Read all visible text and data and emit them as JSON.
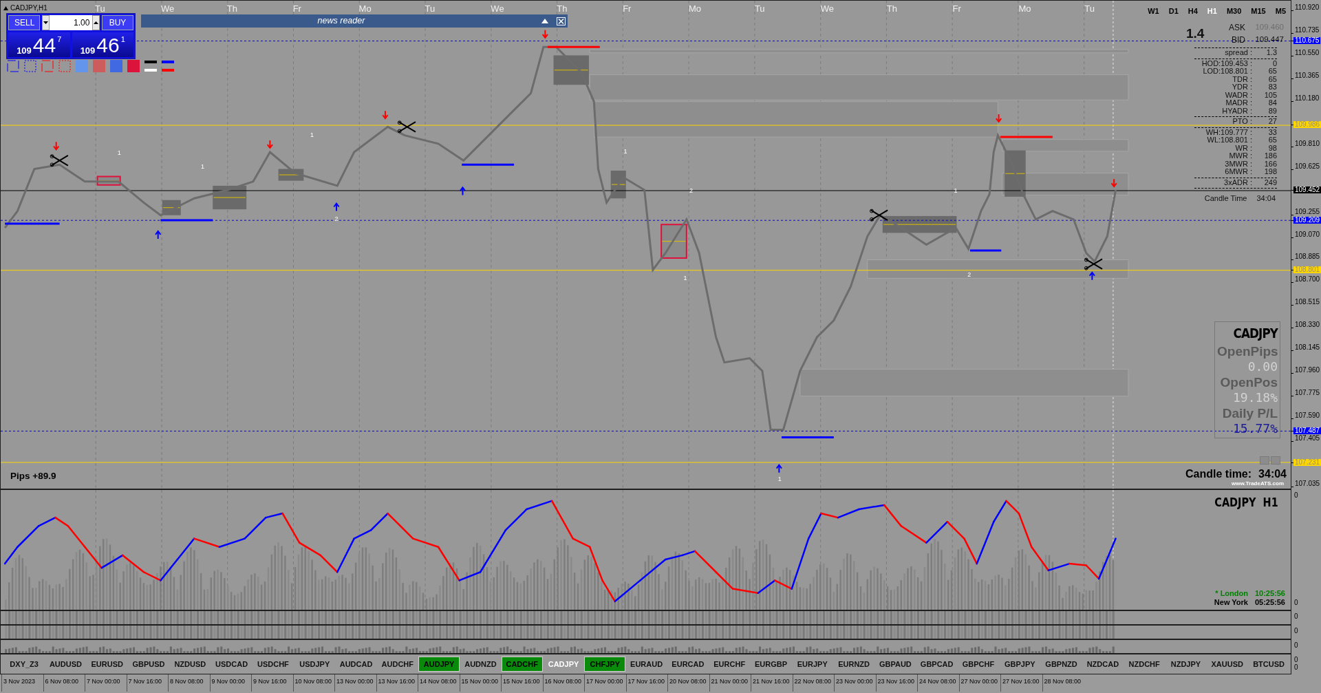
{
  "chart_title": "CADJPY,H1",
  "day_labels": [
    "Tu",
    "We",
    "Th",
    "Fr",
    "Mo",
    "Tu",
    "We",
    "Th",
    "Fr",
    "Mo",
    "Tu",
    "We",
    "Th",
    "Fr",
    "Mo",
    "Tu"
  ],
  "timeframes": [
    {
      "label": "W1",
      "selected": false
    },
    {
      "label": "D1",
      "selected": false
    },
    {
      "label": "H4",
      "selected": false
    },
    {
      "label": "H1",
      "selected": true
    },
    {
      "label": "M30",
      "selected": false
    },
    {
      "label": "M15",
      "selected": false
    },
    {
      "label": "M5",
      "selected": false
    }
  ],
  "trade_panel": {
    "sell": "SELL",
    "buy": "BUY",
    "lot": "1.00",
    "sell_price": {
      "big": "109",
      "main": "44",
      "small": "7"
    },
    "buy_price": {
      "big": "109",
      "main": "46",
      "small": "1"
    }
  },
  "news_reader": {
    "title": "news reader"
  },
  "info_panel": {
    "spread_big": "1.4",
    "quotes": [
      {
        "label": "ASK",
        "value": "109.460",
        "faded": true
      },
      {
        "label": "BID",
        "value": "109.447",
        "faded": false
      }
    ],
    "groups": [
      [
        {
          "label": "spread :",
          "value": "1.3"
        }
      ],
      [
        {
          "label": "HOD:109.453 :",
          "value": "0"
        },
        {
          "label": "LOD:108.801 :",
          "value": "65"
        },
        {
          "label": "TDR :",
          "value": "65"
        },
        {
          "label": "YDR :",
          "value": "83"
        },
        {
          "label": "WADR :",
          "value": "105"
        },
        {
          "label": "MADR :",
          "value": "84"
        },
        {
          "label": "HYADR :",
          "value": "89"
        }
      ],
      [
        {
          "label": "PTO :",
          "value": "27"
        }
      ],
      [
        {
          "label": "WH:109.777 :",
          "value": "33"
        },
        {
          "label": "WL:108.801 :",
          "value": "65"
        },
        {
          "label": "WR :",
          "value": "98"
        },
        {
          "label": "MWR :",
          "value": "186"
        },
        {
          "label": "3MWR :",
          "value": "166"
        },
        {
          "label": "6MWR :",
          "value": "198"
        }
      ],
      [
        {
          "label": "3xADR :",
          "value": "249"
        }
      ]
    ],
    "candle_time": {
      "label": "Candle Time",
      "value": "34:04"
    }
  },
  "price_axis": [
    {
      "text": "110.920",
      "kind": "tick"
    },
    {
      "text": "110.735",
      "kind": "tick"
    },
    {
      "text": "110.675",
      "kind": "marker",
      "color": "#0000ff",
      "dashed": true
    },
    {
      "text": "110.550",
      "kind": "tick"
    },
    {
      "text": "110.365",
      "kind": "tick"
    },
    {
      "text": "110.180",
      "kind": "tick"
    },
    {
      "text": "109.986",
      "kind": "marker",
      "color": "#ffd700",
      "dashed": false
    },
    {
      "text": "109.810",
      "kind": "tick"
    },
    {
      "text": "109.625",
      "kind": "tick"
    },
    {
      "text": "109.452",
      "kind": "marker",
      "color": "#000000",
      "dashed": false
    },
    {
      "text": "109.255",
      "kind": "tick"
    },
    {
      "text": "109.209",
      "kind": "marker",
      "color": "#0000ff",
      "dashed": true
    },
    {
      "text": "109.070",
      "kind": "tick"
    },
    {
      "text": "108.885",
      "kind": "tick"
    },
    {
      "text": "108.801",
      "kind": "marker",
      "color": "#ffd700",
      "dashed": false
    },
    {
      "text": "108.700",
      "kind": "tick"
    },
    {
      "text": "108.515",
      "kind": "tick"
    },
    {
      "text": "108.330",
      "kind": "tick"
    },
    {
      "text": "108.145",
      "kind": "tick"
    },
    {
      "text": "107.960",
      "kind": "tick"
    },
    {
      "text": "107.775",
      "kind": "tick"
    },
    {
      "text": "107.590",
      "kind": "tick"
    },
    {
      "text": "107.487",
      "kind": "marker",
      "color": "#0000ff",
      "dashed": true
    },
    {
      "text": "107.405",
      "kind": "tick"
    },
    {
      "text": "107.231",
      "kind": "marker",
      "color": "#ffd700",
      "dashed": false
    },
    {
      "text": "107.035",
      "kind": "tick"
    }
  ],
  "chart_labels": [
    "1",
    "1",
    "1",
    "1",
    "1",
    "1",
    "1",
    "2",
    "2",
    "2"
  ],
  "stats_box": {
    "symbol": "CADJPY",
    "items": [
      {
        "label": "OpenPips",
        "value": "0.00",
        "color": "#d2d2d2"
      },
      {
        "label": "OpenPos",
        "value": "19.18%",
        "color": "#d2d2d2"
      },
      {
        "label": "Daily P/L",
        "value": "15.77%",
        "color": "#1c1c96"
      }
    ]
  },
  "candle_time": {
    "label": "Candle time:",
    "value": "34:04"
  },
  "site": "www.TradeATS.com",
  "pips": "Pips +89.9",
  "indicator": {
    "title": "CADJPY  H1",
    "axis": [
      "0",
      "0"
    ],
    "sessions": [
      {
        "name": "* London",
        "time": "10:25:56",
        "color": "#008000"
      },
      {
        "name": "New York",
        "time": "05:25:56",
        "color": "#000000"
      }
    ]
  },
  "sub_panes": [
    {
      "axis": "0"
    },
    {
      "axis": "0"
    },
    {
      "axis": "0"
    }
  ],
  "symbols": [
    {
      "label": "DXY_Z3",
      "highlighted": false,
      "selected": false
    },
    {
      "label": "AUDUSD",
      "highlighted": false,
      "selected": false
    },
    {
      "label": "EURUSD",
      "highlighted": false,
      "selected": false
    },
    {
      "label": "GBPUSD",
      "highlighted": false,
      "selected": false
    },
    {
      "label": "NZDUSD",
      "highlighted": false,
      "selected": false
    },
    {
      "label": "USDCAD",
      "highlighted": false,
      "selected": false
    },
    {
      "label": "USDCHF",
      "highlighted": false,
      "selected": false
    },
    {
      "label": "USDJPY",
      "highlighted": false,
      "selected": false
    },
    {
      "label": "AUDCAD",
      "highlighted": false,
      "selected": false
    },
    {
      "label": "AUDCHF",
      "highlighted": false,
      "selected": false
    },
    {
      "label": "AUDJPY",
      "highlighted": true,
      "selected": false
    },
    {
      "label": "AUDNZD",
      "highlighted": false,
      "selected": false
    },
    {
      "label": "CADCHF",
      "highlighted": true,
      "selected": false
    },
    {
      "label": "CADJPY",
      "highlighted": false,
      "selected": true
    },
    {
      "label": "CHFJPY",
      "highlighted": true,
      "selected": false
    },
    {
      "label": "EURAUD",
      "highlighted": false,
      "selected": false
    },
    {
      "label": "EURCAD",
      "highlighted": false,
      "selected": false
    },
    {
      "label": "EURCHF",
      "highlighted": false,
      "selected": false
    },
    {
      "label": "EURGBP",
      "highlighted": false,
      "selected": false
    },
    {
      "label": "EURJPY",
      "highlighted": false,
      "selected": false
    },
    {
      "label": "EURNZD",
      "highlighted": false,
      "selected": false
    },
    {
      "label": "GBPAUD",
      "highlighted": false,
      "selected": false
    },
    {
      "label": "GBPCAD",
      "highlighted": false,
      "selected": false
    },
    {
      "label": "GBPCHF",
      "highlighted": false,
      "selected": false
    },
    {
      "label": "GBPJPY",
      "highlighted": false,
      "selected": false
    },
    {
      "label": "GBPNZD",
      "highlighted": false,
      "selected": false
    },
    {
      "label": "NZDCAD",
      "highlighted": false,
      "selected": false
    },
    {
      "label": "NZDCHF",
      "highlighted": false,
      "selected": false
    },
    {
      "label": "NZDJPY",
      "highlighted": false,
      "selected": false
    },
    {
      "label": "XAUUSD",
      "highlighted": false,
      "selected": false
    },
    {
      "label": "BTCUSD",
      "highlighted": false,
      "selected": false
    }
  ],
  "symbol_axis": [
    "0",
    "0"
  ],
  "time_axis": [
    "3 Nov 2023",
    "6 Nov 08:00",
    "7 Nov 00:00",
    "7 Nov 16:00",
    "8 Nov 08:00",
    "9 Nov 00:00",
    "9 Nov 16:00",
    "10 Nov 08:00",
    "13 Nov 00:00",
    "13 Nov 16:00",
    "14 Nov 08:00",
    "15 Nov 00:00",
    "15 Nov 16:00",
    "16 Nov 08:00",
    "17 Nov 00:00",
    "17 Nov 16:00",
    "20 Nov 08:00",
    "21 Nov 00:00",
    "21 Nov 16:00",
    "22 Nov 08:00",
    "23 Nov 00:00",
    "23 Nov 16:00",
    "24 Nov 08:00",
    "27 Nov 00:00",
    "27 Nov 16:00",
    "28 Nov 08:00"
  ]
}
